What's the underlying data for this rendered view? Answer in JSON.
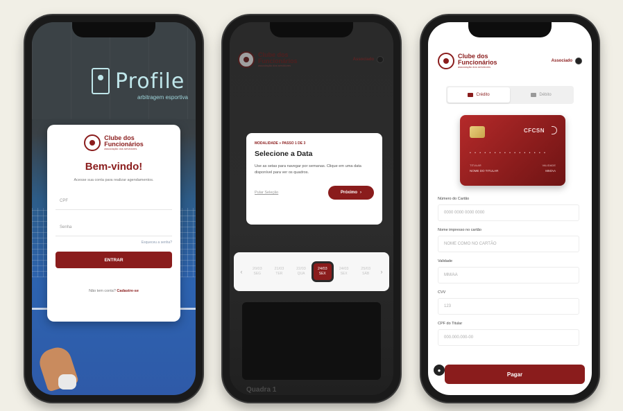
{
  "phone1": {
    "gym_sign": "Profile",
    "gym_sign_sub": "arbitragem esportiva",
    "brand": {
      "line1": "Clube dos",
      "line2": "Funcionários",
      "sub": "associação dos servidores"
    },
    "welcome": "Bem-vindo!",
    "welcome_sub": "Acesse sua conta para realizar agendamentos.",
    "cpf_placeholder": "CPF",
    "password_placeholder": "Senha",
    "forgot": "Esqueceu a senha?",
    "enter_label": "ENTRAR",
    "signup_prompt": "Não tem conta?",
    "signup_link": "Cadastre-se"
  },
  "phone2": {
    "brand": {
      "line1": "Clube dos",
      "line2": "Funcionários",
      "sub": "associação dos servidores"
    },
    "associate": "Associado",
    "tour_step": "MODALIDADE » PASSO 1 DE 3",
    "tour_title": "Selecione a Data",
    "tour_text": "Use as setas para navegar por semanas. Clique em uma data disponível para ver os quadros.",
    "skip": "Pular Seleção",
    "next": "Próximo",
    "days": [
      {
        "num": "20/03",
        "wd": "SEG"
      },
      {
        "num": "21/03",
        "wd": "TER"
      },
      {
        "num": "22/03",
        "wd": "QUA"
      },
      {
        "num": "23/03",
        "wd": "QUI"
      },
      {
        "num": "24/03",
        "wd": "SEX"
      },
      {
        "num": "25/03",
        "wd": "SÁB"
      }
    ],
    "selected_day": {
      "num": "24/03",
      "wd": "SEX"
    },
    "bottom_text": "Quadra 1"
  },
  "phone3": {
    "brand": {
      "line1": "Clube dos",
      "line2": "Funcionários",
      "sub": "associação dos servidores"
    },
    "associate": "Associado",
    "tab_credit": "Crédito",
    "tab_debit": "Débito",
    "card": {
      "brand": "CFCSN",
      "number": "• • • •   • • • •   • • • •   • • • •",
      "holder_label": "TITULAR",
      "holder": "NOME DO TITULAR",
      "valid_label": "VALIDADE",
      "valid": "MM/AA"
    },
    "fields": [
      {
        "label": "Número do Cartão",
        "placeholder": "0000 0000 0000 0000"
      },
      {
        "label": "Nome impresso no cartão",
        "placeholder": "NOME COMO NO CARTÃO"
      },
      {
        "label": "Validade",
        "placeholder": "MM/AA"
      },
      {
        "label": "CVV",
        "placeholder": "123"
      },
      {
        "label": "CPF do Titular",
        "placeholder": "000.000.000-00"
      }
    ],
    "pay_label": "Pagar"
  }
}
